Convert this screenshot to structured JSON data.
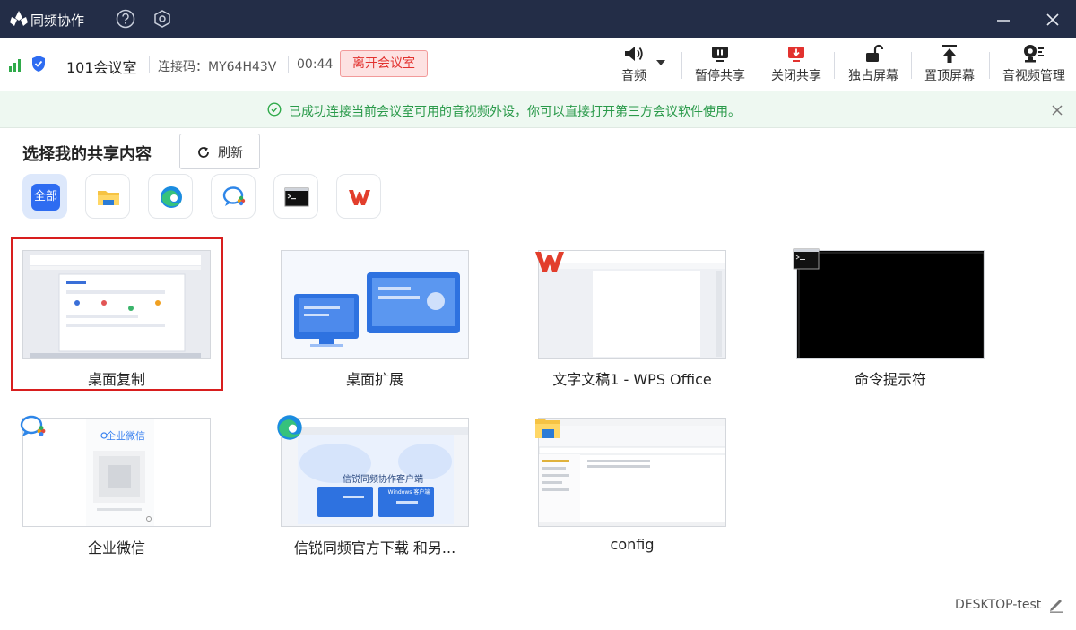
{
  "app": {
    "title": "同频协作"
  },
  "meeting": {
    "room_name": "101会议室",
    "connection_code": "连接码：MY64H43V",
    "timer": "00:44",
    "leave_label": "离开会议室"
  },
  "toolbar": {
    "audio": "音频",
    "pause_share": "暂停共享",
    "close_share": "关闭共享",
    "exclusive_screen": "独占屏幕",
    "pin_screen": "置顶屏幕",
    "av_manage": "音视频管理"
  },
  "notice": {
    "text": "已成功连接当前会议室可用的音视频外设，你可以直接打开第三方会议软件使用。"
  },
  "share": {
    "title": "选择我的共享内容",
    "refresh_label": "刷新",
    "filter_all_label": "全部",
    "filters": [
      "all",
      "file-explorer",
      "edge",
      "wecom",
      "cmd",
      "wps"
    ],
    "items": [
      {
        "label": "桌面复制",
        "selected": true
      },
      {
        "label": "桌面扩展"
      },
      {
        "label": "文字文稿1 - WPS Office"
      },
      {
        "label": "命令提示符"
      },
      {
        "label": "企业微信"
      },
      {
        "label": "信锐同频官方下载 和另..."
      },
      {
        "label": "config"
      }
    ]
  },
  "thumbnails": {
    "wecom_brand": "企业微信",
    "web_heading": "信锐同频协作客户端",
    "win_client": "Windows 客户端"
  },
  "footer": {
    "device_name": "DESKTOP-test"
  },
  "colors": {
    "titlebar": "#232d47",
    "accent": "#2e6cf1",
    "danger": "#e2322f",
    "success": "#2a9a4a"
  }
}
